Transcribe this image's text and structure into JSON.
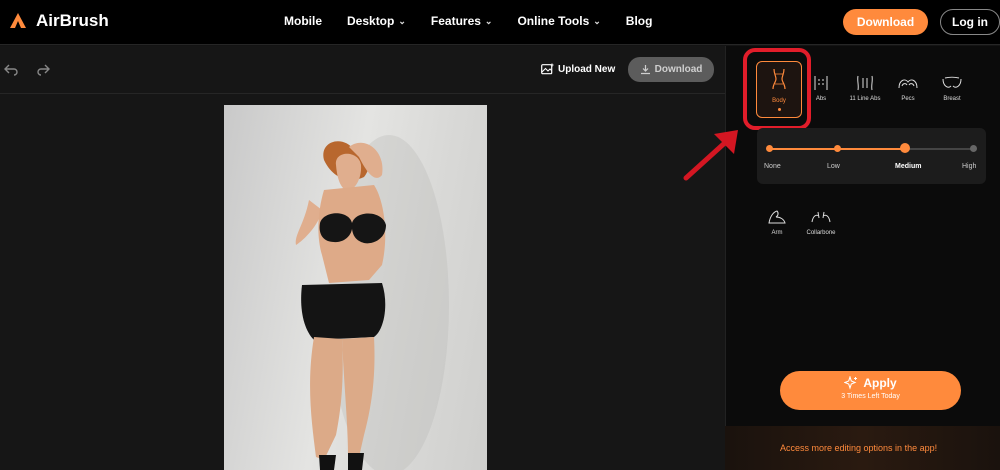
{
  "app": {
    "name": "AirBrush",
    "brand_color": "#ff8a3c"
  },
  "nav": {
    "links": [
      {
        "label": "Mobile",
        "dropdown": false
      },
      {
        "label": "Desktop",
        "dropdown": true
      },
      {
        "label": "Features",
        "dropdown": true
      },
      {
        "label": "Online Tools",
        "dropdown": true
      },
      {
        "label": "Blog",
        "dropdown": false
      }
    ],
    "download_label": "Download",
    "login_label": "Log in"
  },
  "toolbar": {
    "upload_label": "Upload New",
    "download_label": "Download",
    "undo_icon": "undo-icon",
    "redo_icon": "redo-icon"
  },
  "tools": {
    "row1": [
      {
        "label": "Body",
        "icon": "body-icon",
        "active": true
      },
      {
        "label": "Abs",
        "icon": "abs-icon",
        "active": false
      },
      {
        "label": "11 Line Abs",
        "icon": "11-line-abs-icon",
        "active": false
      },
      {
        "label": "Pecs",
        "icon": "pecs-icon",
        "active": false
      },
      {
        "label": "Breast",
        "icon": "breast-icon",
        "active": false
      }
    ],
    "row2": [
      {
        "label": "Arm",
        "icon": "arm-icon",
        "active": false
      },
      {
        "label": "Collarbone",
        "icon": "collarbone-icon",
        "active": false
      }
    ]
  },
  "intensity": {
    "levels": [
      "None",
      "Low",
      "Medium",
      "High"
    ],
    "selected": "Medium",
    "selected_index": 2
  },
  "apply": {
    "label": "Apply",
    "sub_label": "3 Times Left Today"
  },
  "promo": {
    "text": "Access more editing options in the app!"
  }
}
